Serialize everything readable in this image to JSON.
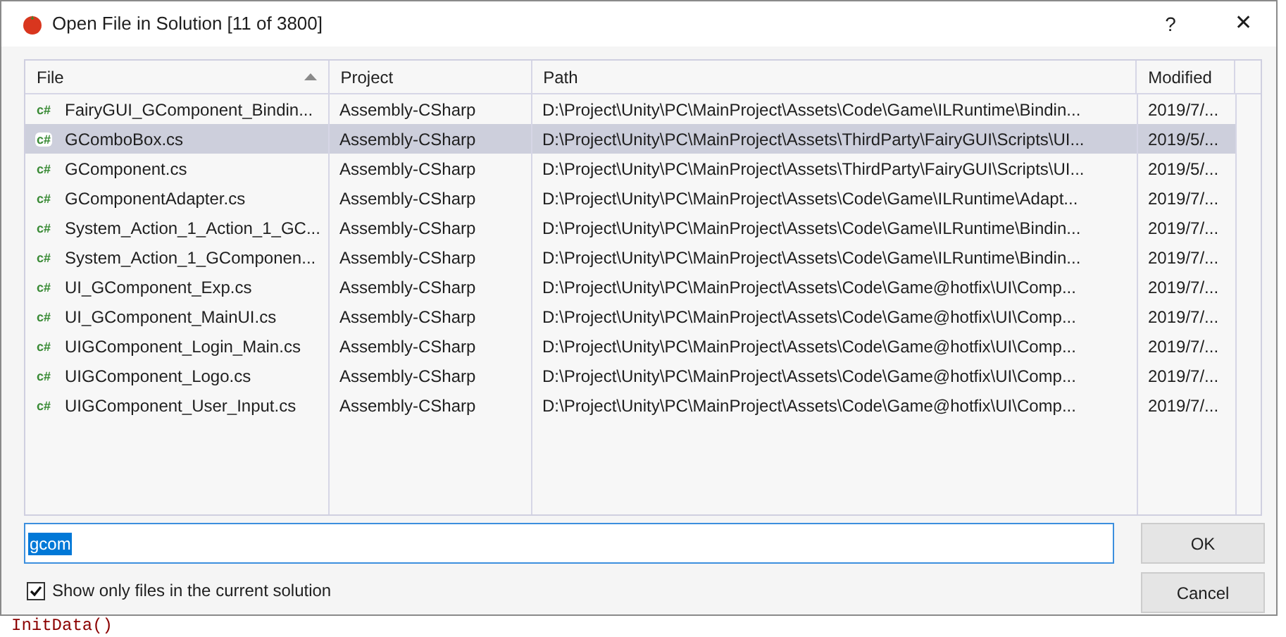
{
  "window": {
    "title": "Open File in Solution [11 of 3800]",
    "help": "?",
    "close": "✕"
  },
  "editor": {
    "line": "InitData()"
  },
  "table": {
    "columns": [
      {
        "label": "File",
        "sorted": true
      },
      {
        "label": "Project",
        "sorted": false
      },
      {
        "label": "Path",
        "sorted": false
      },
      {
        "label": "Modified",
        "sorted": false
      }
    ],
    "rows": [
      {
        "icon": "c#",
        "file": "FairyGUI_GComponent_Bindin...",
        "project": "Assembly-CSharp",
        "path": "D:\\Project\\Unity\\PC\\MainProject\\Assets\\Code\\Game\\ILRuntime\\Bindin...",
        "modified": "2019/7/...",
        "selected": false
      },
      {
        "icon": "c#",
        "file": "GComboBox.cs",
        "project": "Assembly-CSharp",
        "path": "D:\\Project\\Unity\\PC\\MainProject\\Assets\\ThirdParty\\FairyGUI\\Scripts\\UI...",
        "modified": "2019/5/...",
        "selected": true
      },
      {
        "icon": "c#",
        "file": "GComponent.cs",
        "project": "Assembly-CSharp",
        "path": "D:\\Project\\Unity\\PC\\MainProject\\Assets\\ThirdParty\\FairyGUI\\Scripts\\UI...",
        "modified": "2019/5/...",
        "selected": false
      },
      {
        "icon": "c#",
        "file": "GComponentAdapter.cs",
        "project": "Assembly-CSharp",
        "path": "D:\\Project\\Unity\\PC\\MainProject\\Assets\\Code\\Game\\ILRuntime\\Adapt...",
        "modified": "2019/7/...",
        "selected": false
      },
      {
        "icon": "c#",
        "file": "System_Action_1_Action_1_GC...",
        "project": "Assembly-CSharp",
        "path": "D:\\Project\\Unity\\PC\\MainProject\\Assets\\Code\\Game\\ILRuntime\\Bindin...",
        "modified": "2019/7/...",
        "selected": false
      },
      {
        "icon": "c#",
        "file": "System_Action_1_GComponen...",
        "project": "Assembly-CSharp",
        "path": "D:\\Project\\Unity\\PC\\MainProject\\Assets\\Code\\Game\\ILRuntime\\Bindin...",
        "modified": "2019/7/...",
        "selected": false
      },
      {
        "icon": "c#",
        "file": "UI_GComponent_Exp.cs",
        "project": "Assembly-CSharp",
        "path": "D:\\Project\\Unity\\PC\\MainProject\\Assets\\Code\\Game@hotfix\\UI\\Comp...",
        "modified": "2019/7/...",
        "selected": false
      },
      {
        "icon": "c#",
        "file": "UI_GComponent_MainUI.cs",
        "project": "Assembly-CSharp",
        "path": "D:\\Project\\Unity\\PC\\MainProject\\Assets\\Code\\Game@hotfix\\UI\\Comp...",
        "modified": "2019/7/...",
        "selected": false
      },
      {
        "icon": "c#",
        "file": "UIGComponent_Login_Main.cs",
        "project": "Assembly-CSharp",
        "path": "D:\\Project\\Unity\\PC\\MainProject\\Assets\\Code\\Game@hotfix\\UI\\Comp...",
        "modified": "2019/7/...",
        "selected": false
      },
      {
        "icon": "c#",
        "file": "UIGComponent_Logo.cs",
        "project": "Assembly-CSharp",
        "path": "D:\\Project\\Unity\\PC\\MainProject\\Assets\\Code\\Game@hotfix\\UI\\Comp...",
        "modified": "2019/7/...",
        "selected": false
      },
      {
        "icon": "c#",
        "file": "UIGComponent_User_Input.cs",
        "project": "Assembly-CSharp",
        "path": "D:\\Project\\Unity\\PC\\MainProject\\Assets\\Code\\Game@hotfix\\UI\\Comp...",
        "modified": "2019/7/...",
        "selected": false
      }
    ]
  },
  "search": {
    "value": "gcom"
  },
  "checkbox": {
    "label": "Show only files in the current solution",
    "checked": true
  },
  "buttons": [
    {
      "label": "OK"
    },
    {
      "label": "Cancel"
    }
  ]
}
